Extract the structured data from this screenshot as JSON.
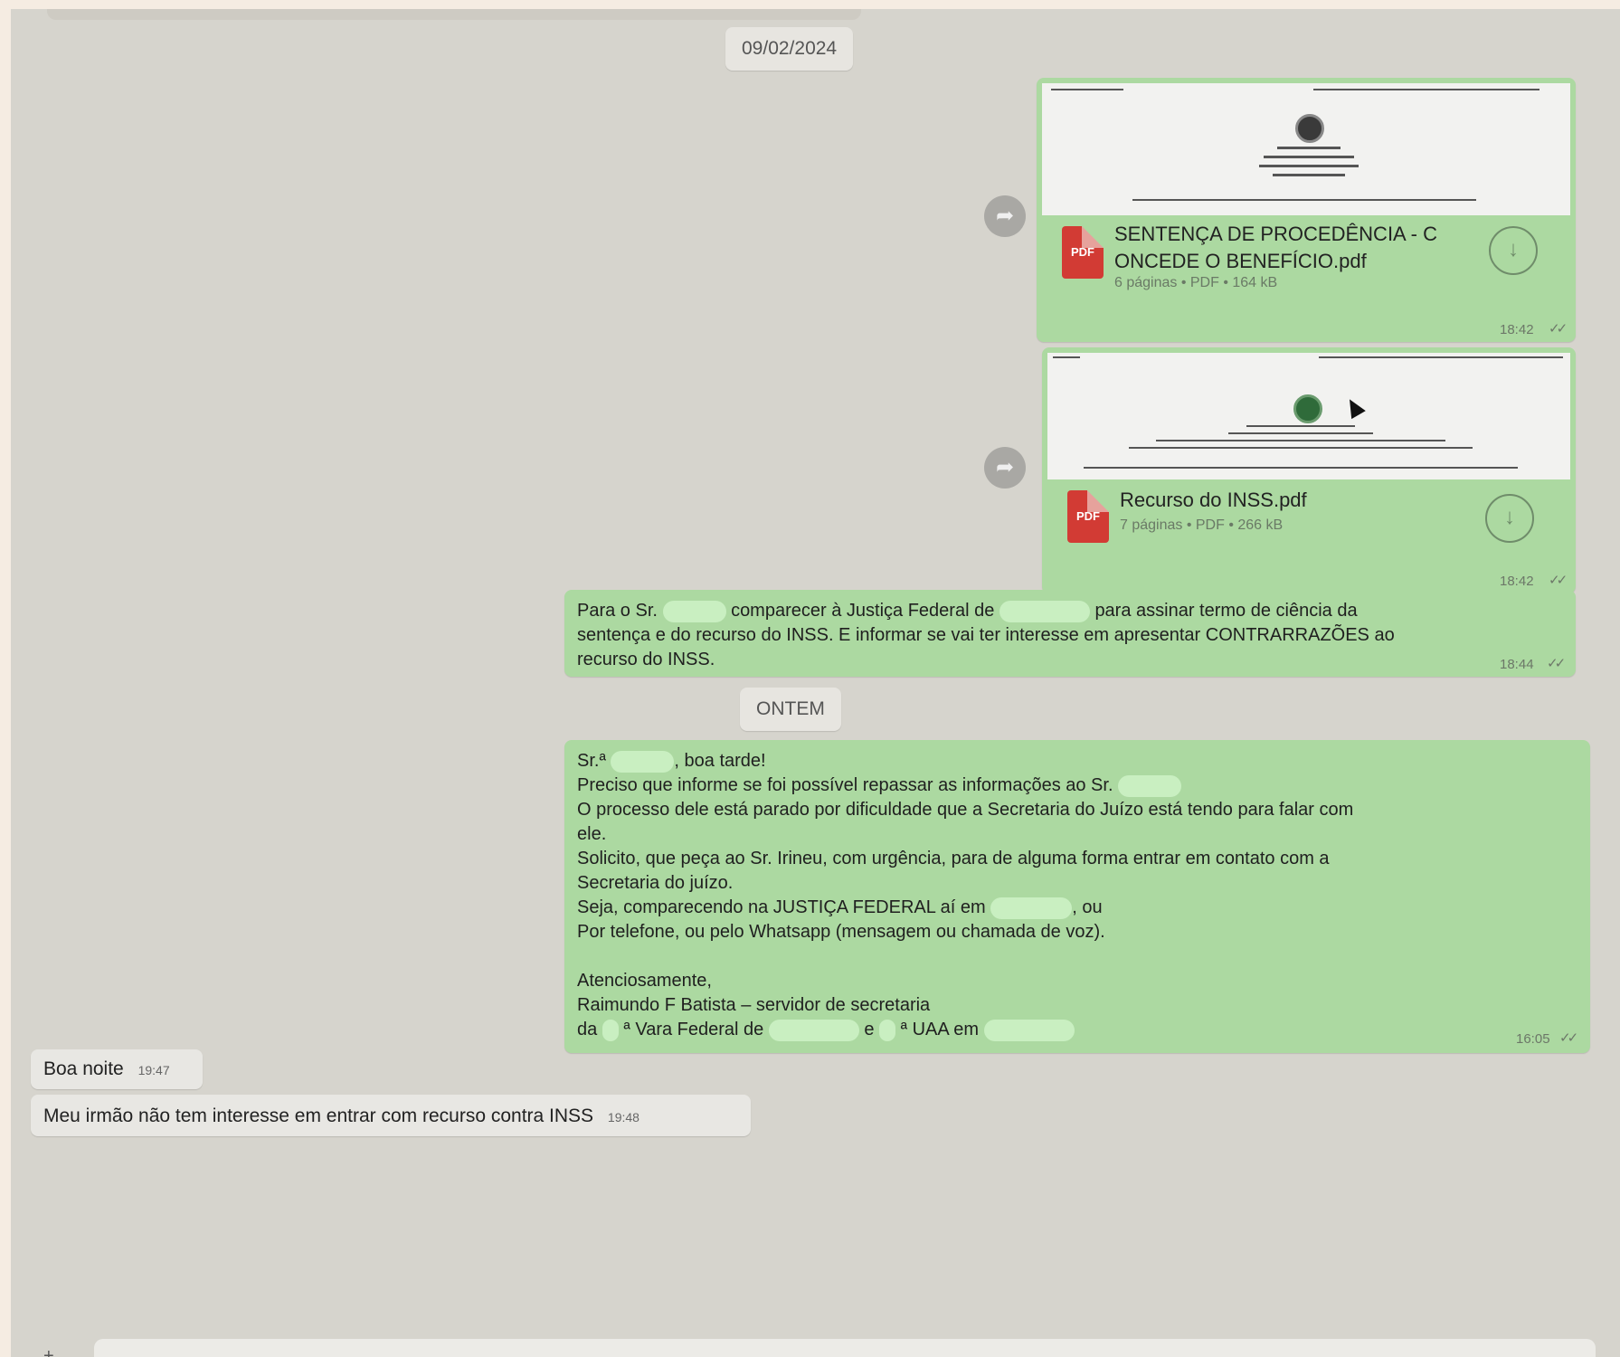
{
  "date_chips": {
    "first": "09/02/2024",
    "second": "ONTEM"
  },
  "file_messages": [
    {
      "name_line1": "SENTENÇA DE PROCEDÊNCIA - C",
      "name_line2": "ONCEDE O BENEFÍCIO.pdf",
      "meta": "6 páginas • PDF • 164 kB",
      "time": "18:42",
      "icon_label": "PDF"
    },
    {
      "name_line1": "Recurso do INSS.pdf",
      "name_line2": "",
      "meta": "7 páginas • PDF • 266 kB",
      "time": "18:42",
      "icon_label": "PDF"
    }
  ],
  "message_contrarrazoes": {
    "part1": "Para o Sr.",
    "part2": "comparecer à Justiça Federal de",
    "part3": "para assinar termo de ciência da",
    "line2": "sentença e do recurso do INSS.  E informar se vai ter interesse em apresentar CONTRARRAZÕES ao",
    "line3": "recurso do INSS.",
    "time": "18:44"
  },
  "message_secretaria": {
    "l1a": "Sr.ª",
    "l1b": ", boa tarde!",
    "l2": "Preciso que informe se foi possível repassar as informações ao Sr.",
    "l3": "O processo dele está parado por dificuldade que a Secretaria do Juízo está tendo para falar com",
    "l4": "ele.",
    "l5": "Solicito, que peça ao Sr. Irineu, com urgência, para de alguma forma entrar em contato com a",
    "l6": "Secretaria do juízo.",
    "l7a": "Seja, comparecendo na JUSTIÇA FEDERAL aí em",
    "l7b": ", ou",
    "l8": "Por telefone, ou pelo Whatsapp (mensagem ou chamada de voz).",
    "l9": "Atenciosamente,",
    "l10": "Raimundo F Batista – servidor de secretaria",
    "l11a": "da",
    "l11b": "ª Vara Federal de",
    "l11c": "e",
    "l11d": "ª UAA em",
    "time": "16:05"
  },
  "incoming": [
    {
      "text": "Boa noite",
      "time": "19:47"
    },
    {
      "text": "Meu irmão não tem interesse em entrar com recurso contra INSS",
      "time": "19:48"
    }
  ],
  "icons": {
    "forward": "forward-icon",
    "download": "download-icon",
    "ticks": "double-check-icon"
  },
  "colors": {
    "outgoing_bubble": "#acd9a1",
    "incoming_bubble": "#e8e7e3",
    "chat_background": "#d6d4cd",
    "pdf_red": "#d23b34"
  }
}
